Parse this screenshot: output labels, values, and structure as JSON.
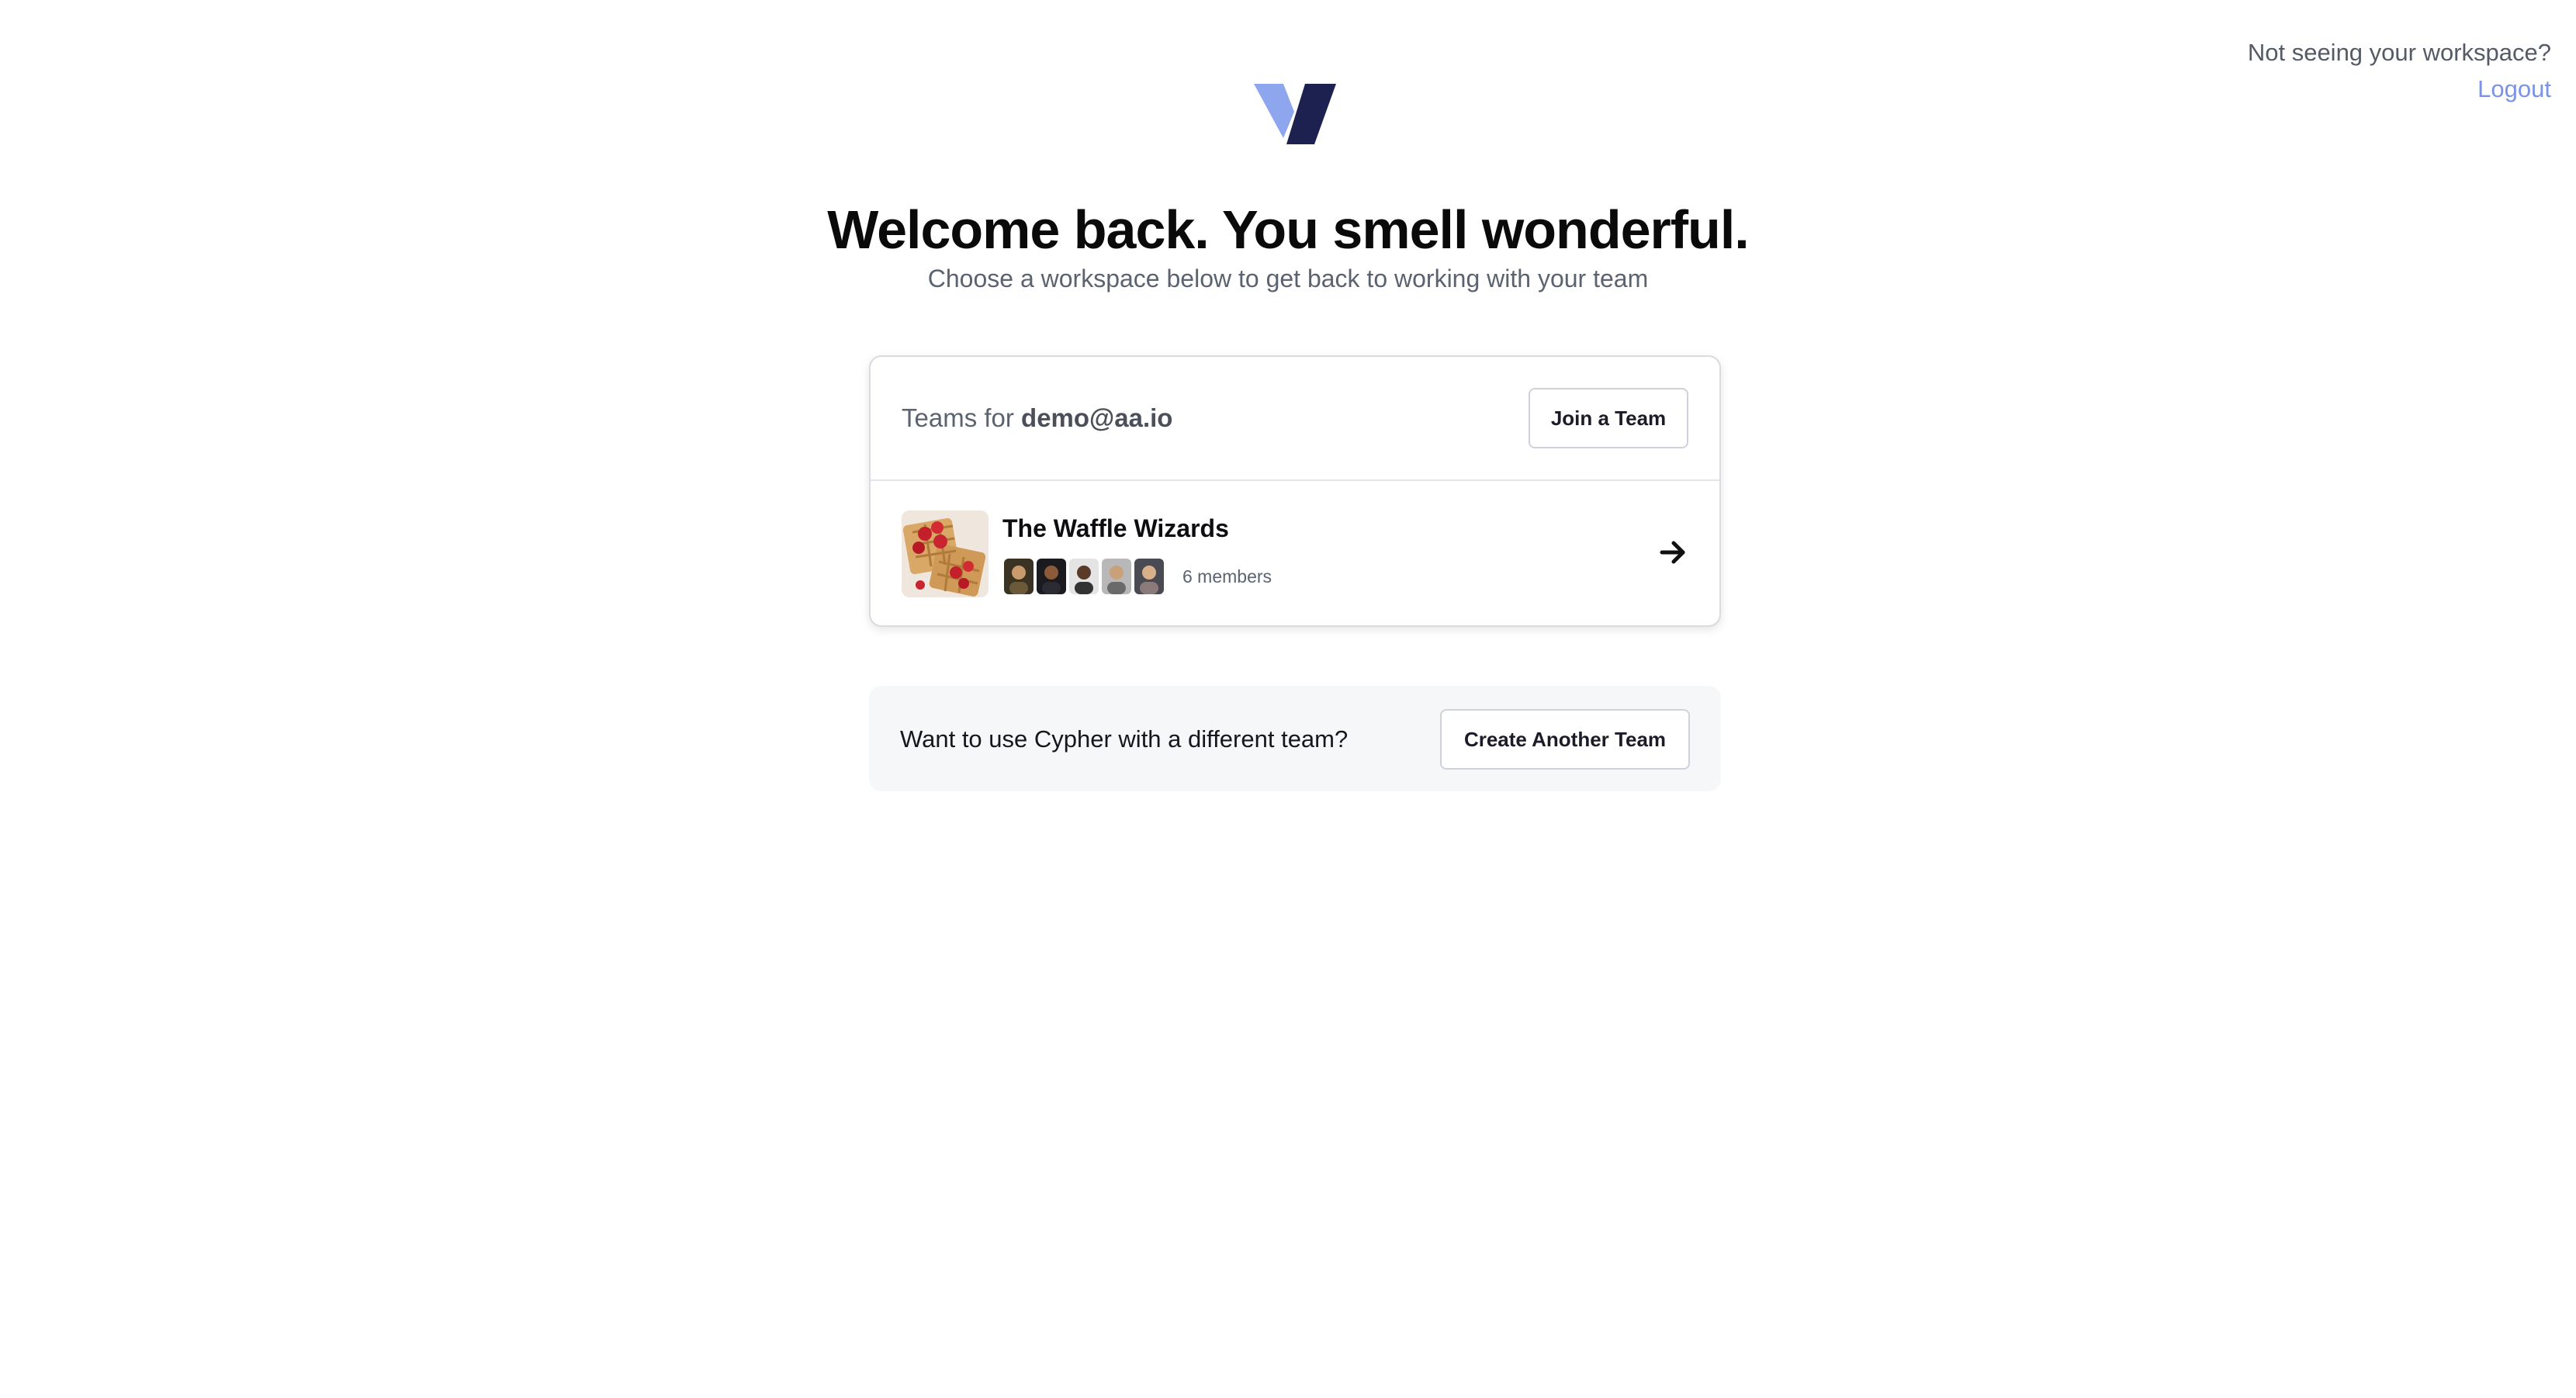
{
  "header": {
    "help_text": "Not seeing your workspace?",
    "logout_label": "Logout"
  },
  "brand": {
    "logo_icon": "v-check-logo-icon",
    "logo_colors": [
      "#8ea6ee",
      "#1d2150"
    ]
  },
  "hero": {
    "title": "Welcome back. You smell wonderful.",
    "subtitle": "Choose a workspace below to get back to working with your team"
  },
  "teams_card": {
    "label_prefix": "Teams for",
    "email": "demo@aa.io",
    "join_button_label": "Join a Team",
    "teams": [
      {
        "name": "The Waffle Wizards",
        "thumbnail_icon": "waffle-image",
        "member_count_label": "6 members",
        "avatar_count": 5,
        "open_icon": "arrow-right-icon"
      }
    ]
  },
  "banner": {
    "text": "Want to use Cypher with a different team?",
    "button_label": "Create Another Team"
  },
  "colors": {
    "link": "#7a93e6",
    "text_muted": "#5b6270",
    "banner_bg": "#f6f7f8"
  }
}
